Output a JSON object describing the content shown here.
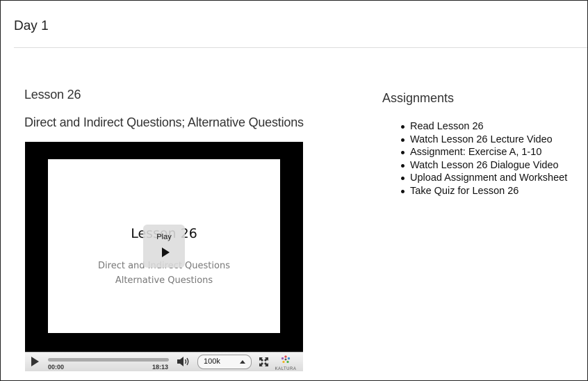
{
  "page": {
    "heading": "Day 1"
  },
  "lesson": {
    "title": "Lesson 26",
    "subtitle": "Direct and Indirect Questions; Alternative Questions"
  },
  "player": {
    "slide_title": "Lesson 26",
    "slide_line1": "Direct and Indirect Questions",
    "slide_line2": "Alternative Questions",
    "overlay_label": "Play",
    "current_time": "00:00",
    "duration": "18:13",
    "quality": "100k",
    "brand": "KALTURA",
    "icons": [
      "play-icon",
      "volume-icon",
      "fullscreen-icon",
      "kaltura-logo"
    ]
  },
  "assignments": {
    "title": "Assignments",
    "items": [
      "Read Lesson 26",
      "Watch Lesson 26 Lecture Video",
      "Assignment: Exercise A, 1-10",
      "Watch Lesson 26 Dialogue Video",
      "Upload Assignment and Worksheet",
      "Take Quiz for Lesson 26"
    ]
  }
}
